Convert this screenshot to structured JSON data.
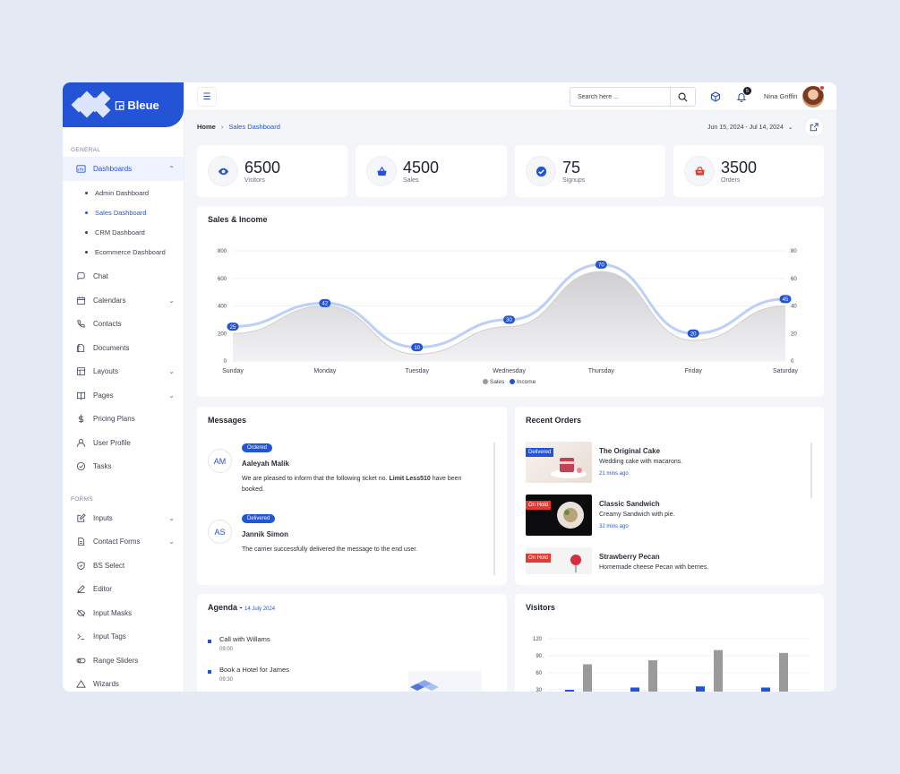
{
  "brand": {
    "name": "Bleue"
  },
  "sidebar": {
    "general_label": "GENERAL",
    "forms_label": "FORMS",
    "dashboards": {
      "label": "Dashboards",
      "items": [
        "Admin Dashboard",
        "Sales Dashboard",
        "CRM Dashboard",
        "Ecommerce Dashboard"
      ],
      "active": "Sales Dashboard"
    },
    "general_items": [
      {
        "label": "Chat",
        "icon": "chat-icon",
        "chevron": false
      },
      {
        "label": "Calendars",
        "icon": "calendar-icon",
        "chevron": true
      },
      {
        "label": "Contacts",
        "icon": "phone-icon",
        "chevron": false
      },
      {
        "label": "Documents",
        "icon": "documents-icon",
        "chevron": false
      },
      {
        "label": "Layouts",
        "icon": "layout-icon",
        "chevron": true
      },
      {
        "label": "Pages",
        "icon": "book-icon",
        "chevron": true
      },
      {
        "label": "Pricing Plans",
        "icon": "dollar-icon",
        "chevron": false
      },
      {
        "label": "User Profile",
        "icon": "user-icon",
        "chevron": false
      },
      {
        "label": "Tasks",
        "icon": "check-circle-icon",
        "chevron": false
      }
    ],
    "form_items": [
      {
        "label": "Inputs",
        "icon": "edit-icon",
        "chevron": true
      },
      {
        "label": "Contact Forms",
        "icon": "file-icon",
        "chevron": true
      },
      {
        "label": "BS Select",
        "icon": "shield-icon",
        "chevron": false
      },
      {
        "label": "Editor",
        "icon": "pen-icon",
        "chevron": false
      },
      {
        "label": "Input Masks",
        "icon": "eye-off-icon",
        "chevron": false
      },
      {
        "label": "Input Tags",
        "icon": "terminal-icon",
        "chevron": false
      },
      {
        "label": "Range Sliders",
        "icon": "toggle-icon",
        "chevron": false
      },
      {
        "label": "Wizards",
        "icon": "triangle-icon",
        "chevron": false
      }
    ]
  },
  "topbar": {
    "search_placeholder": "Search here ...",
    "notification_count": "5",
    "user_name": "Nina Griffin"
  },
  "breadcrumb": {
    "home": "Home",
    "current": "Sales Dashboard"
  },
  "date_range": "Jun 15, 2024 - Jul 14, 2024",
  "stats": [
    {
      "value": "6500",
      "label": "Visitors",
      "icon": "eye-icon",
      "color": "#2454d6"
    },
    {
      "value": "4500",
      "label": "Sales",
      "icon": "basket-icon",
      "color": "#2454d6"
    },
    {
      "value": "75",
      "label": "Signups",
      "icon": "check-badge-icon",
      "color": "#2454d6"
    },
    {
      "value": "3500",
      "label": "Orders",
      "icon": "cart-icon",
      "color": "#e53935"
    }
  ],
  "sales_income": {
    "title": "Sales & Income"
  },
  "chart_data": [
    {
      "type": "area",
      "title": "Sales & Income",
      "categories": [
        "Sunday",
        "Monday",
        "Tuesday",
        "Wednesday",
        "Thursday",
        "Friday",
        "Saturday"
      ],
      "series": [
        {
          "name": "Sales",
          "axis": "left",
          "values": [
            200,
            400,
            50,
            250,
            650,
            150,
            400
          ],
          "color": "#d7d7d9"
        },
        {
          "name": "Income",
          "axis": "right",
          "values": [
            25,
            42,
            10,
            30,
            70,
            20,
            45
          ],
          "color": "#bcd0f7"
        }
      ],
      "y_left": {
        "ticks": [
          0,
          200,
          400,
          600,
          800
        ],
        "range": [
          0,
          800
        ]
      },
      "y_right": {
        "ticks": [
          0,
          20,
          40,
          60,
          80
        ],
        "range": [
          0,
          80
        ]
      },
      "legend": "bottom"
    },
    {
      "type": "bar",
      "title": "Visitors",
      "series": [
        {
          "values": [
            30,
            34,
            36,
            34
          ],
          "color": "#2454d6"
        },
        {
          "values": [
            75,
            82,
            100,
            95
          ],
          "color": "#9a9a9a"
        }
      ],
      "y_ticks": [
        30,
        60,
        90,
        120
      ]
    }
  ],
  "messages": {
    "title": "Messages",
    "items": [
      {
        "initials": "AM",
        "status": "Ordered",
        "name": "Aaleyah Malik",
        "text_before": "We are pleased to inform that the following ticket no. ",
        "text_bold": "Limit Less510",
        "text_after": " have been booked."
      },
      {
        "initials": "AS",
        "status": "Delivered",
        "name": "Jannik Simon",
        "text_before": "The carrier successfully delivered the message to the end user.",
        "text_bold": "",
        "text_after": ""
      }
    ]
  },
  "orders": {
    "title": "Recent Orders",
    "items": [
      {
        "status": "Delivered",
        "status_color": "#2454d6",
        "name": "The Original Cake",
        "desc": "Wedding cake with macarons.",
        "time": "21 mins ago"
      },
      {
        "status": "On Hold",
        "status_color": "#e53935",
        "name": "Classic Sandwich",
        "desc": "Creamy Sandwich with pie.",
        "time": "32 mins ago"
      },
      {
        "status": "On Hold",
        "status_color": "#e53935",
        "name": "Strawberry Pecan",
        "desc": "Homemade cheese Pecan with berries.",
        "time": ""
      }
    ]
  },
  "agenda": {
    "title": "Agenda",
    "separator": "-",
    "date": "14 July 2024",
    "items": [
      {
        "title": "Call with Willams",
        "time": "09:00"
      },
      {
        "title": "Book a Hotel for James",
        "time": "09:30"
      }
    ]
  },
  "visitors": {
    "title": "Visitors"
  }
}
